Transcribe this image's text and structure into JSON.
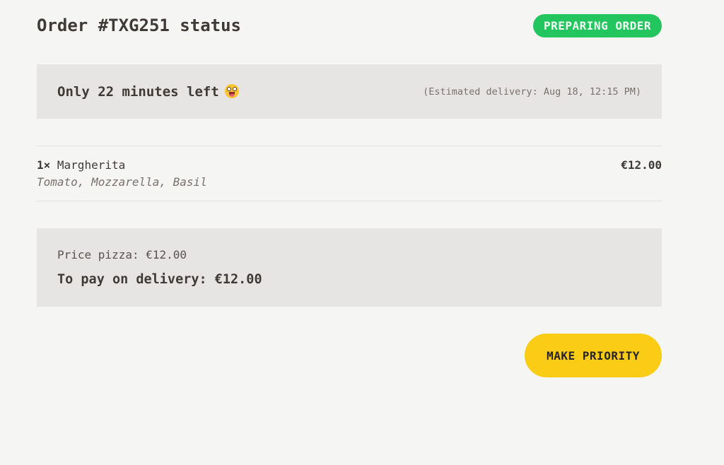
{
  "order": {
    "title": "Order #TXG251 status",
    "status_badge": "PREPARING ORDER"
  },
  "delivery": {
    "time_left": "Only 22 minutes left",
    "emoji": "grinning-face-with-tongue",
    "estimated": "(Estimated delivery: Aug 18, 12:15 PM)"
  },
  "items": [
    {
      "quantity": "1×",
      "name": "Margherita",
      "ingredients": "Tomato, Mozzarella, Basil",
      "price": "€12.00"
    }
  ],
  "summary": {
    "price_pizza": "Price pizza: €12.00",
    "to_pay": "To pay on delivery: €12.00"
  },
  "actions": {
    "make_priority": "MAKE PRIORITY"
  },
  "colors": {
    "background": "#f5f5f3",
    "panel": "#e7e5e3",
    "badge_green": "#22c55e",
    "button_yellow": "#facc15"
  }
}
